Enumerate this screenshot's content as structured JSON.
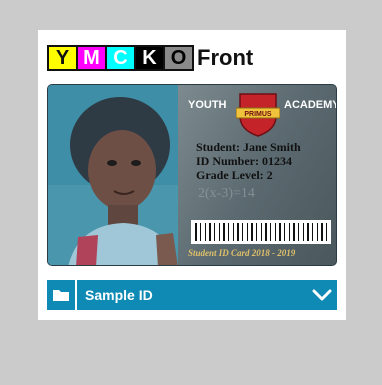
{
  "color_channels": [
    "Y",
    "M",
    "C",
    "K",
    "O"
  ],
  "side_label": "Front",
  "card": {
    "school_left": "YOUTH",
    "school_right": "ACADEMY",
    "crest_text": "PRIMUS",
    "student_line": "Student: Jane Smith",
    "id_line": "ID Number: 01234",
    "grade_line": "Grade Level: 2",
    "footer": "Student ID Card 2018 - 2019"
  },
  "selector": {
    "value": "Sample ID",
    "folder_icon": "folder-icon",
    "expand_icon": "chevron-down-icon"
  },
  "colors": {
    "accent": "#0f8ab4",
    "background": "#cbcbcb"
  }
}
